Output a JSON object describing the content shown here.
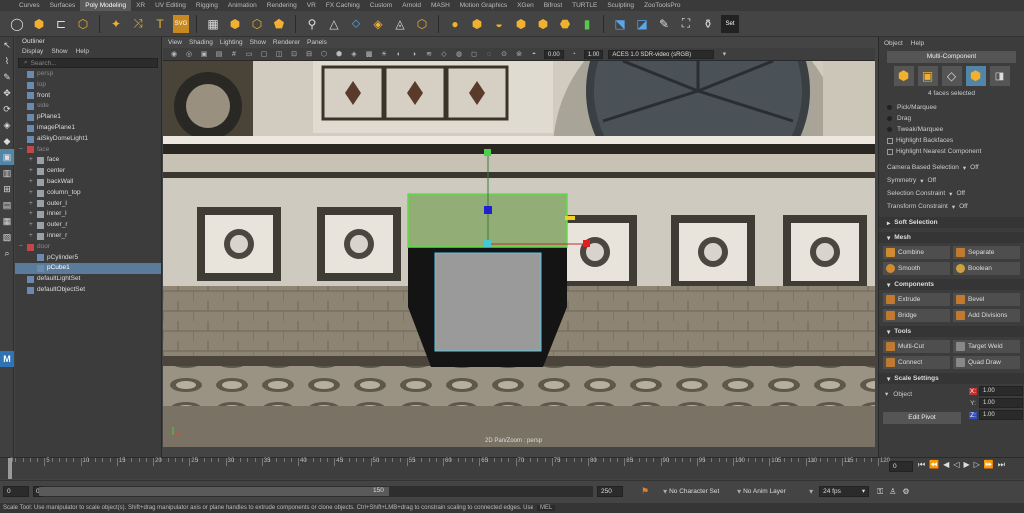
{
  "shelf": {
    "tabs": [
      "Curves",
      "Surfaces",
      "Poly Modeling",
      "XR",
      "UV Editing",
      "Rigging",
      "Animation",
      "Rendering",
      "VR",
      "FX Caching",
      "Custom",
      "Arnold",
      "MASH",
      "Motion Graphics",
      "XGen",
      "Bifrost",
      "TURTLE",
      "Sculpting",
      "ZooToolsPro"
    ],
    "active": "Poly Modeling",
    "icons": [
      "sphere-icon",
      "cube-icon",
      "cylinder-icon",
      "plane-icon",
      "torus-icon",
      "disc-icon",
      "polygon-icon",
      "star-icon",
      "sweep-icon",
      "text-icon",
      "svg-icon",
      "grid-icon",
      "hex-icon",
      "hex-outline-icon",
      "hex-solid-icon",
      "plus-icon",
      "vertex-icon",
      "triangle-icon",
      "quad-icon",
      "combine-icon",
      "separate-icon",
      "extract-icon",
      "smooth-icon",
      "extrude-icon",
      "bridge-icon",
      "bevel-icon",
      "weld-icon",
      "merge-icon",
      "multicut-icon",
      "bracket-icon",
      "pen-icon",
      "paint-icon",
      "sculpt-icon",
      "sort-icon"
    ],
    "text_icons": {
      "t": "T",
      "svg": "SVG",
      "set": "Set"
    }
  },
  "outliner": {
    "title": "Outliner",
    "menu": [
      "Display",
      "Show",
      "Help"
    ],
    "search_placeholder": "Search...",
    "items": [
      {
        "label": "persp",
        "indent": 0,
        "dim": true,
        "exp": ""
      },
      {
        "label": "top",
        "indent": 0,
        "dim": true,
        "exp": ""
      },
      {
        "label": "front",
        "indent": 0,
        "dim": false,
        "exp": ""
      },
      {
        "label": "side",
        "indent": 0,
        "dim": true,
        "exp": ""
      },
      {
        "label": "pPlane1",
        "indent": 0,
        "dim": false,
        "exp": ""
      },
      {
        "label": "imagePlane1",
        "indent": 0,
        "dim": false,
        "exp": ""
      },
      {
        "label": "aiSkyDomeLight1",
        "indent": 0,
        "dim": false,
        "exp": ""
      },
      {
        "label": "face",
        "indent": 0,
        "dim": true,
        "exp": "−"
      },
      {
        "label": "face",
        "indent": 1,
        "dim": false,
        "exp": "+"
      },
      {
        "label": "center",
        "indent": 1,
        "dim": false,
        "exp": "+"
      },
      {
        "label": "backWall",
        "indent": 1,
        "dim": false,
        "exp": "+"
      },
      {
        "label": "column_top",
        "indent": 1,
        "dim": false,
        "exp": "+"
      },
      {
        "label": "outer_l",
        "indent": 1,
        "dim": false,
        "exp": "+"
      },
      {
        "label": "inner_l",
        "indent": 1,
        "dim": false,
        "exp": "+"
      },
      {
        "label": "outer_r",
        "indent": 1,
        "dim": false,
        "exp": "+"
      },
      {
        "label": "inner_r",
        "indent": 1,
        "dim": false,
        "exp": "+"
      },
      {
        "label": "door",
        "indent": 0,
        "dim": true,
        "exp": "−"
      },
      {
        "label": "pCylinder5",
        "indent": 1,
        "dim": false,
        "exp": ""
      },
      {
        "label": "pCube1",
        "indent": 1,
        "dim": false,
        "exp": "",
        "sel": true
      },
      {
        "label": "defaultLightSet",
        "indent": 0,
        "dim": false,
        "exp": ""
      },
      {
        "label": "defaultObjectSet",
        "indent": 0,
        "dim": false,
        "exp": ""
      }
    ]
  },
  "viewport": {
    "menu": [
      "View",
      "Shading",
      "Lighting",
      "Show",
      "Renderer",
      "Panels"
    ],
    "field_a": "0.00",
    "field_b": "1.00",
    "colorspace": "ACES 1.0 SDR-video (sRGB)",
    "panel_label": "2D Pan/Zoom : persp"
  },
  "modeling_toolkit": {
    "menu": [
      "Object",
      "Help"
    ],
    "mode": "Multi-Component",
    "faces_selected": "4 faces selected",
    "pick": "Pick/Marquee",
    "drag": "Drag",
    "tweak": "Tweak/Marquee",
    "highlight_backfaces": "Highlight Backfaces",
    "highlight_nearest": "Highlight Nearest Component",
    "camera_based": "Camera Based Selection",
    "camera_based_val": "Off",
    "symmetry": "Symmetry",
    "symmetry_val": "Off",
    "sel_constraint": "Selection Constraint",
    "sel_constraint_val": "Off",
    "xform_constraint": "Transform Constraint",
    "xform_constraint_val": "Off",
    "soft_selection": "Soft Selection",
    "mesh": "Mesh",
    "combine": "Combine",
    "separate": "Separate",
    "smooth": "Smooth",
    "boolean": "Boolean",
    "components": "Components",
    "extrude": "Extrude",
    "bevel": "Bevel",
    "bridge": "Bridge",
    "add_divisions": "Add Divisions",
    "tools": "Tools",
    "multicut": "Multi-Cut",
    "target_weld": "Target Weld",
    "connect": "Connect",
    "quad_draw": "Quad Draw",
    "scale_settings": "Scale Settings",
    "object": "Object",
    "x_label": "X:",
    "y_label": "Y:",
    "z_label": "Z:",
    "x": "1.00",
    "y": "1.00",
    "z": "1.00",
    "edit_pivot": "Edit Pivot"
  },
  "timeline": {
    "ticks": [
      "0",
      "5",
      "10",
      "15",
      "20",
      "25",
      "30",
      "35",
      "40",
      "45",
      "50",
      "55",
      "60",
      "65",
      "70",
      "75",
      "80",
      "85",
      "90",
      "95",
      "100",
      "105",
      "110",
      "115",
      "120"
    ],
    "current_frame": "0"
  },
  "range": {
    "start": "0",
    "inner_start": "0",
    "handle": "150",
    "end": "250",
    "character_set": "No Character Set",
    "anim_layer": "No Anim Layer",
    "fps": "24 fps"
  },
  "help_line": "Scale Tool: Use manipulator to scale object(s). Shift+drag manipulator axis or plane handles to extrude components or clone objects. Ctrl+Shift+LMB+drag to constrain scaling to connected edges. Use D or INSERT",
  "mel": "MEL"
}
